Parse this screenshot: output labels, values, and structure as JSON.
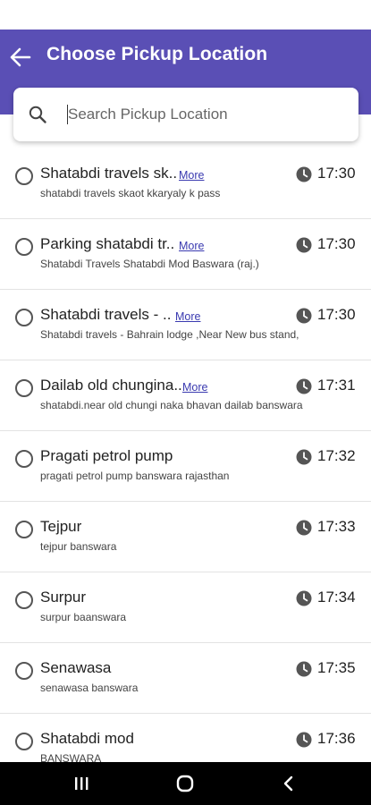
{
  "header": {
    "title": "Choose Pickup Location",
    "back_icon": "arrow-left-icon",
    "color": "#5a4fb5"
  },
  "search": {
    "placeholder": "Search Pickup Location",
    "value": "",
    "icon": "search-icon"
  },
  "more_label": "More",
  "more_color": "#3a3ab0",
  "stops": [
    {
      "name": "Shatabdi travels sk..",
      "has_more": true,
      "address": "shatabdi travels skaot kkaryaly k pass",
      "time": "17:30"
    },
    {
      "name": "Parking shatabdi tr..",
      "has_more": true,
      "address": "Shatabdi Travels Shatabdi Mod Baswara (raj.)",
      "time": "17:30"
    },
    {
      "name": "Shatabdi travels - ..",
      "has_more": true,
      "address": "Shatabdi travels - Bahrain lodge ,Near New bus stand,",
      "time": "17:30"
    },
    {
      "name": "Dailab old chungina..",
      "has_more": true,
      "address": "shatabdi.near old chungi naka bhavan dailab banswara",
      "time": "17:31"
    },
    {
      "name": "Pragati petrol pump",
      "has_more": false,
      "address": "pragati petrol pump banswara rajasthan",
      "time": "17:32"
    },
    {
      "name": "Tejpur",
      "has_more": false,
      "address": "tejpur banswara",
      "time": "17:33"
    },
    {
      "name": "Surpur",
      "has_more": false,
      "address": "surpur baanswara",
      "time": "17:34"
    },
    {
      "name": "Senawasa",
      "has_more": false,
      "address": "senawasa banswara",
      "time": "17:35"
    },
    {
      "name": "Shatabdi mod",
      "has_more": false,
      "address": "BANSWARA",
      "time": "17:36"
    }
  ],
  "navbar": {
    "recents_icon": "recents-icon",
    "home_icon": "home-icon",
    "back_icon": "back-chevron-icon"
  }
}
